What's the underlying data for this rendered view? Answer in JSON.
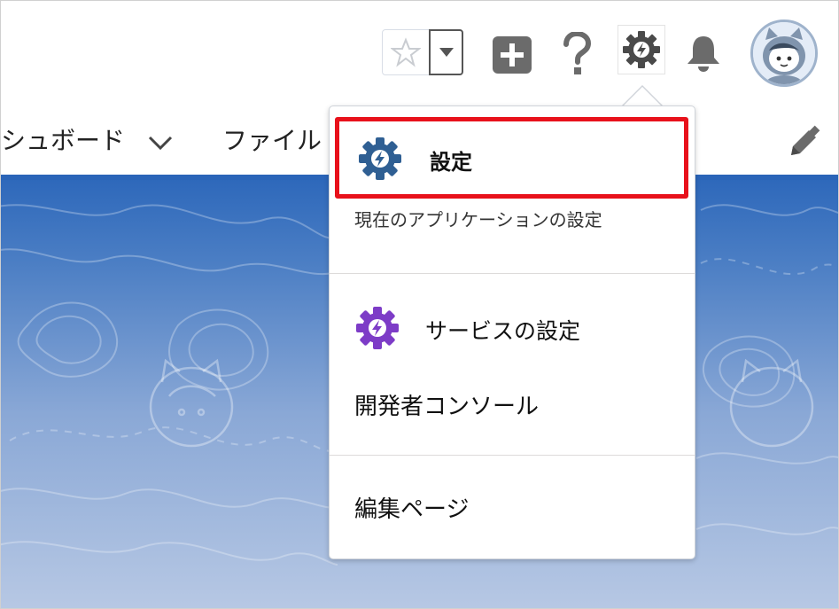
{
  "nav": {
    "dashboard_label": "シュボード",
    "files_label": "ファイル"
  },
  "icons": {
    "favorites": "star-icon",
    "favorites_menu": "triangle-down-icon",
    "global_actions": "plus-icon",
    "help": "question-icon",
    "setup": "gear-lightning-icon",
    "notifications": "bell-icon",
    "user": "avatar-icon",
    "edit": "pencil-icon"
  },
  "setup_menu": {
    "setup_label": "設定",
    "setup_sublabel": "現在のアプリケーションの設定",
    "service_setup_label": "サービスの設定",
    "developer_console_label": "開発者コンソール",
    "edit_page_label": "編集ページ"
  },
  "colors": {
    "highlight": "#e8111b",
    "setup_gear": "#2f5f93",
    "service_gear": "#7d3cc7",
    "banner": "#2c67ba"
  }
}
